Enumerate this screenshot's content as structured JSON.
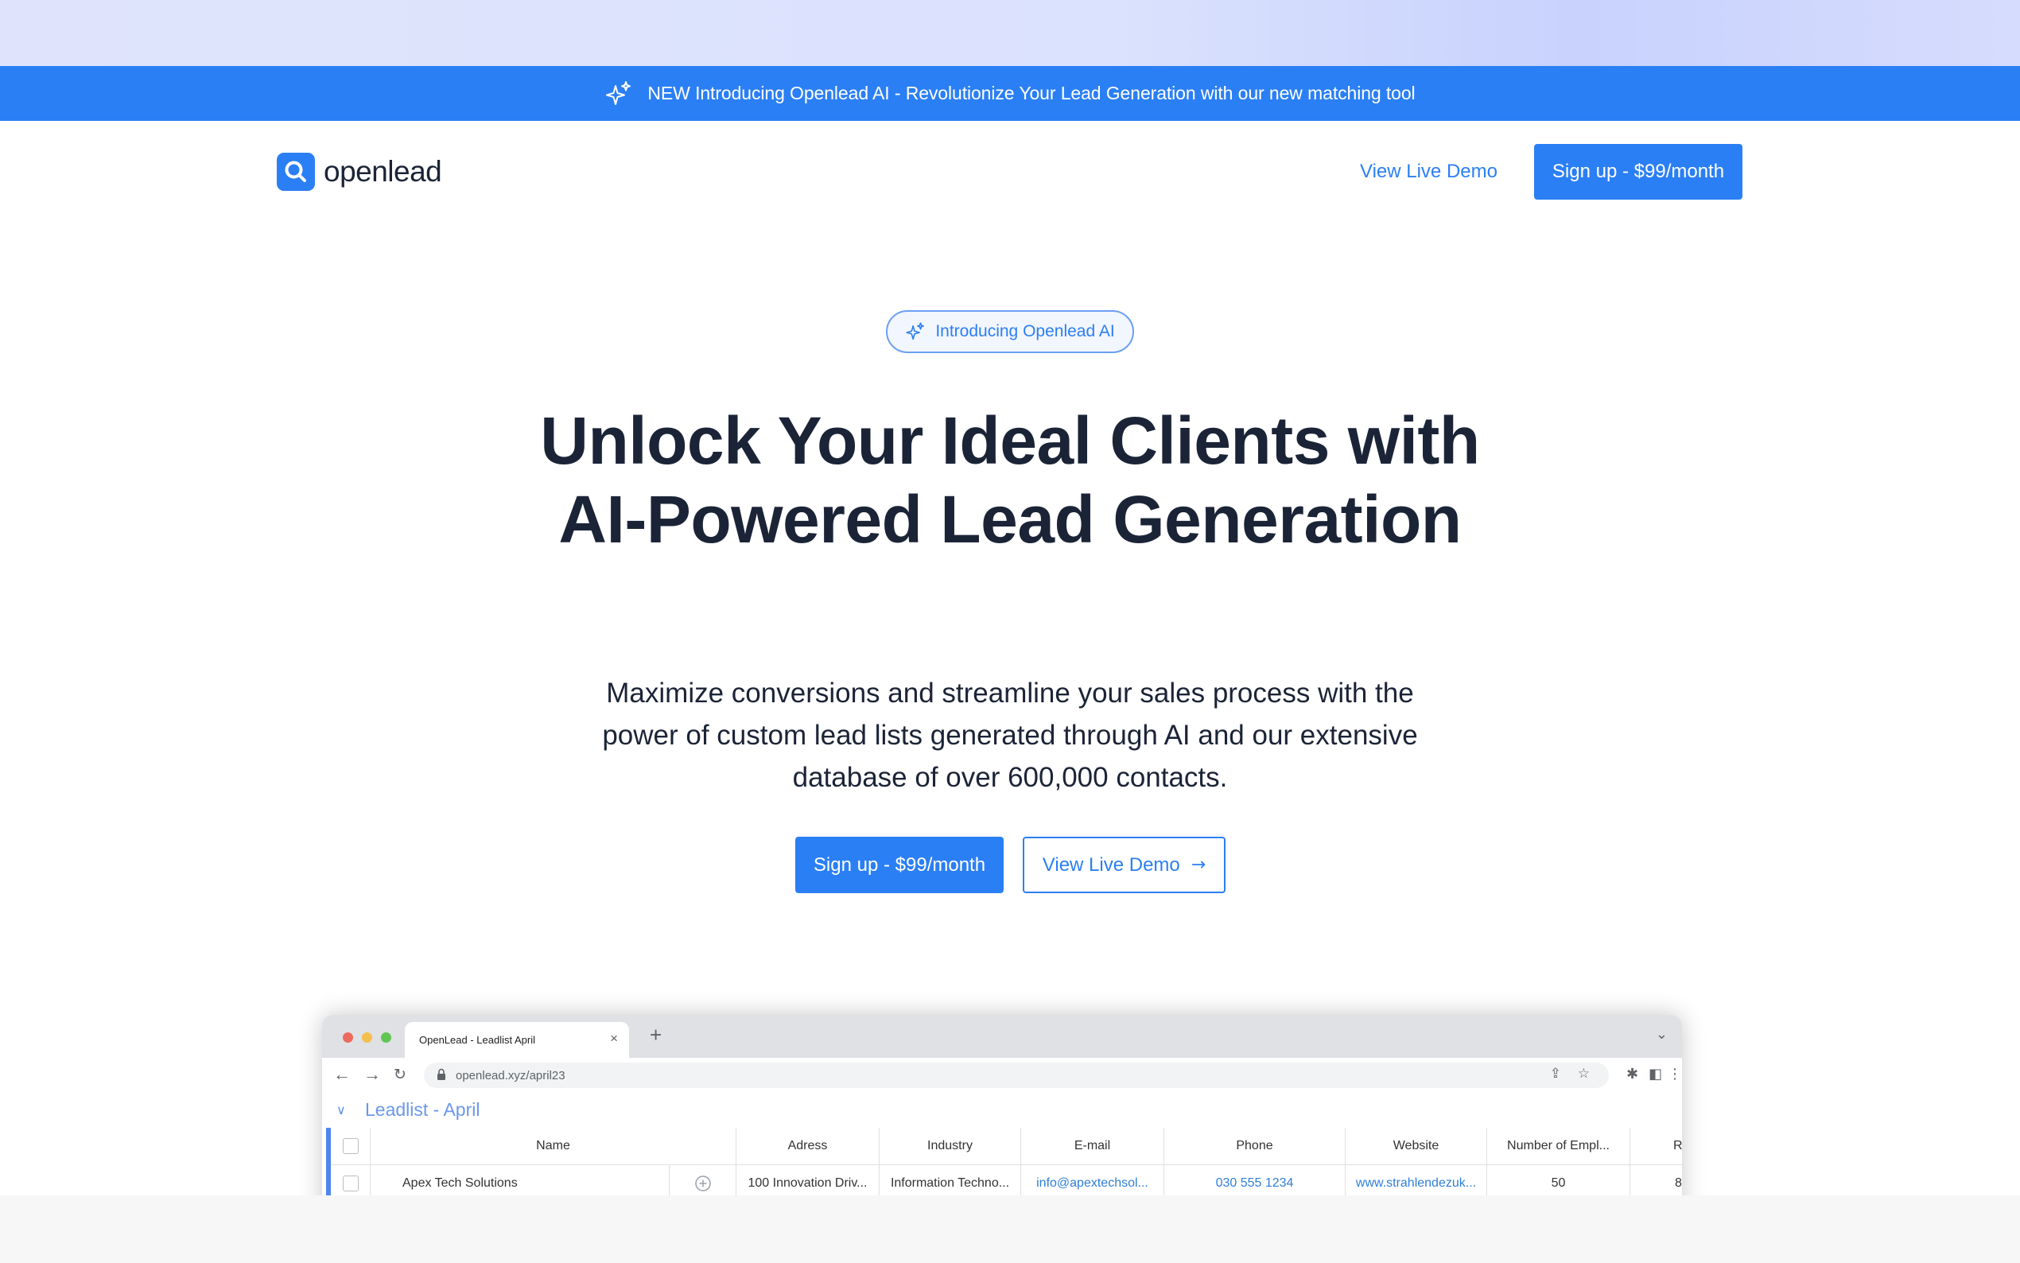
{
  "banner": {
    "icon": "sparkles-icon",
    "text": "NEW Introducing Openlead AI - Revolutionize Your Lead Generation with our new matching tool"
  },
  "nav": {
    "logo_text": "openlead",
    "demo_label": "View Live Demo",
    "signup_label": "Sign up - $99/month"
  },
  "hero": {
    "pill_label": "Introducing Openlead AI",
    "title": "Unlock Your Ideal Clients with AI-Powered Lead Generation",
    "subtitle": "Maximize conversions and streamline your sales process with the power of custom lead lists generated through AI and our extensive database of over 600,000 contacts.",
    "signup_label": "Sign up - $99/month",
    "demo_label": "View Live Demo",
    "demo_arrow": "→"
  },
  "mockup": {
    "tab_title": "OpenLead - Leadlist April",
    "tab_close": "×",
    "new_tab": "+",
    "url": "openlead.xyz/april23",
    "list_title": "Leadlist - April",
    "columns": [
      "Name",
      "Adress",
      "Industry",
      "E-mail",
      "Phone",
      "Website",
      "Number of Empl...",
      "Re"
    ],
    "row": {
      "name": "Apex Tech Solutions",
      "address": "100 Innovation Driv...",
      "industry": "Information Techno...",
      "email": "info@apextechsol...",
      "phone": "030 555 1234",
      "website": "www.strahlendezuk...",
      "employees": "50",
      "re": "8"
    }
  },
  "colors": {
    "accent": "#2b7ff4",
    "heading": "#1b2437",
    "list_title": "#6a98ea"
  }
}
